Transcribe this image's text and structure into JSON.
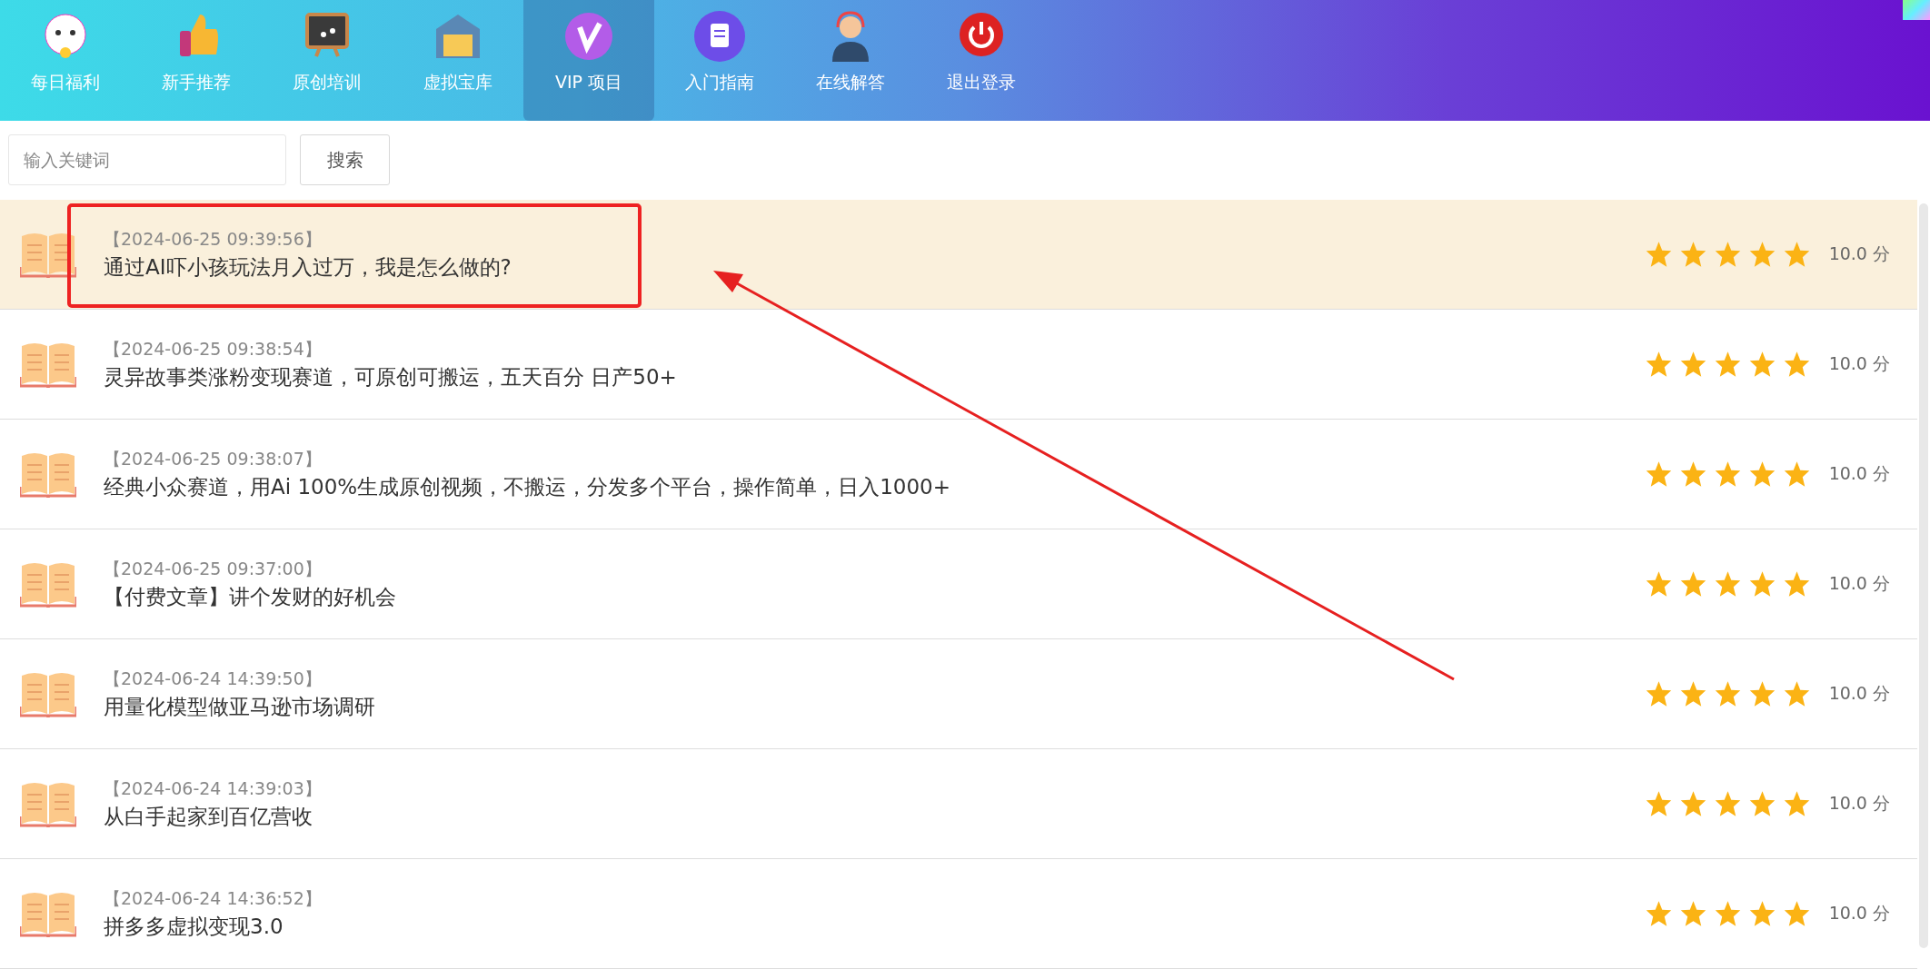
{
  "nav": [
    {
      "label": "每日福利",
      "selected": false
    },
    {
      "label": "新手推荐",
      "selected": false
    },
    {
      "label": "原创培训",
      "selected": false
    },
    {
      "label": "虚拟宝库",
      "selected": false
    },
    {
      "label": "VIP 项目",
      "selected": true
    },
    {
      "label": "入门指南",
      "selected": false
    },
    {
      "label": "在线解答",
      "selected": false
    },
    {
      "label": "退出登录",
      "selected": false
    }
  ],
  "search": {
    "placeholder": "输入关键词",
    "button": "搜索"
  },
  "articles": [
    {
      "date": "【2024-06-25 09:39:56】",
      "title": "通过AI吓小孩玩法月入过万，我是怎么做的?",
      "stars": 5,
      "score": "10.0 分",
      "selected": true
    },
    {
      "date": "【2024-06-25 09:38:54】",
      "title": "灵异故事类涨粉变现赛道，可原创可搬运，五天百分 日产50+",
      "stars": 5,
      "score": "10.0 分",
      "selected": false
    },
    {
      "date": "【2024-06-25 09:38:07】",
      "title": "经典小众赛道，用Ai 100%生成原创视频，不搬运，分发多个平台，操作简单，日入1000+",
      "stars": 5,
      "score": "10.0 分",
      "selected": false
    },
    {
      "date": "【2024-06-25 09:37:00】",
      "title": "【付费文章】讲个发财的好机会",
      "stars": 5,
      "score": "10.0 分",
      "selected": false
    },
    {
      "date": "【2024-06-24 14:39:50】",
      "title": "用量化模型做亚马逊市场调研",
      "stars": 5,
      "score": "10.0 分",
      "selected": false
    },
    {
      "date": "【2024-06-24 14:39:03】",
      "title": "从白手起家到百亿营收",
      "stars": 5,
      "score": "10.0 分",
      "selected": false
    },
    {
      "date": "【2024-06-24 14:36:52】",
      "title": "拼多多虚拟变现3.0",
      "stars": 5,
      "score": "10.0 分",
      "selected": false
    }
  ]
}
